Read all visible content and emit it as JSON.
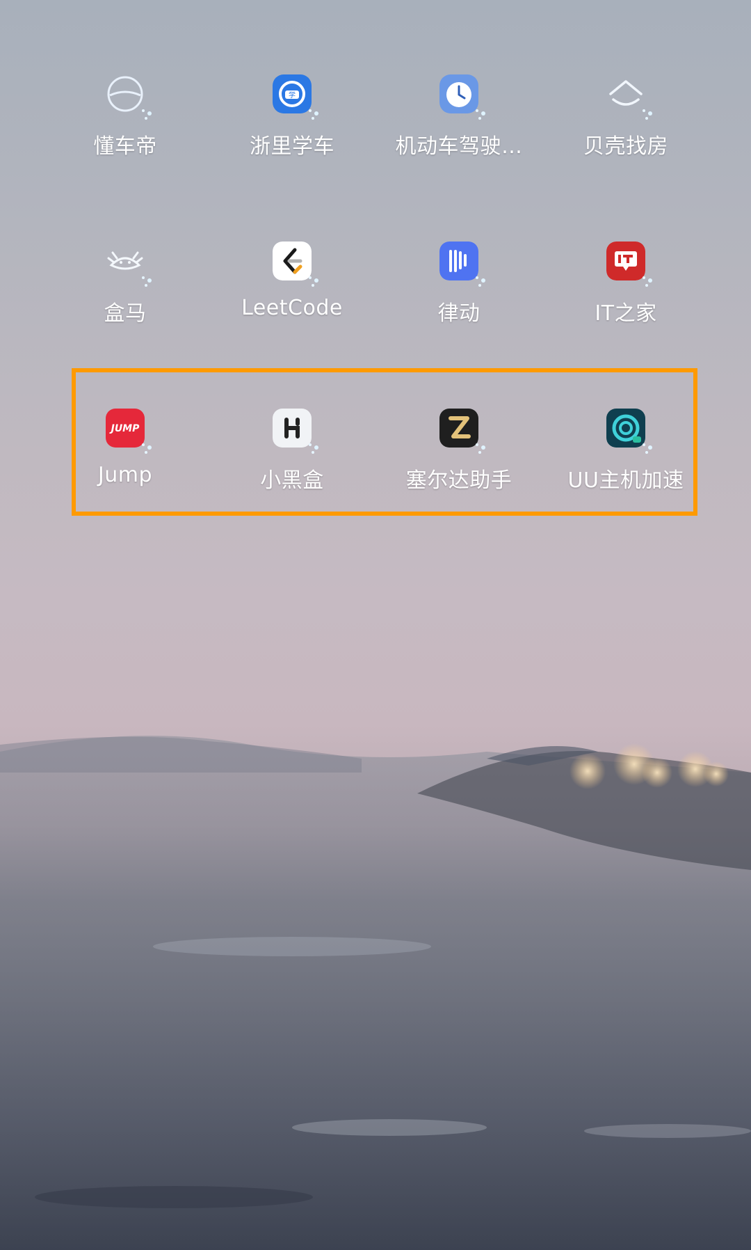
{
  "home_screen": {
    "rows": [
      [
        {
          "name": "懂车帝",
          "icon": "steering-wheel-icon",
          "color": "#a9c4e3"
        },
        {
          "name": "浙里学车",
          "icon": "driving-school-icon",
          "color": "#2b78e4"
        },
        {
          "name": "机动车驾驶…",
          "icon": "clock-icon",
          "color": "#6a98e6"
        },
        {
          "name": "贝壳找房",
          "icon": "house-outline-icon",
          "color": "#dfe6ef"
        }
      ],
      [
        {
          "name": "盒马",
          "icon": "hema-mascot-icon",
          "color": "#cdd7e3"
        },
        {
          "name": "LeetCode",
          "icon": "leetcode-icon",
          "color": "#ffffff"
        },
        {
          "name": "律动",
          "icon": "rhythm-bars-icon",
          "color": "#4f73f1"
        },
        {
          "name": "IT之家",
          "icon": "it-home-icon",
          "color": "#cf2a2a"
        }
      ],
      [
        {
          "name": "Jump",
          "icon": "jump-logo-icon",
          "color": "#e5283a"
        },
        {
          "name": "小黑盒",
          "icon": "xiaoheihe-icon",
          "color": "#f1f3f6"
        },
        {
          "name": "塞尔达助手",
          "icon": "zelda-z-icon",
          "color": "#1f1f1f"
        },
        {
          "name": "UU主机加速",
          "icon": "uu-accelerator-icon",
          "color": "#0f3f4f"
        }
      ]
    ]
  },
  "highlight": {
    "color": "#ff9a00"
  }
}
